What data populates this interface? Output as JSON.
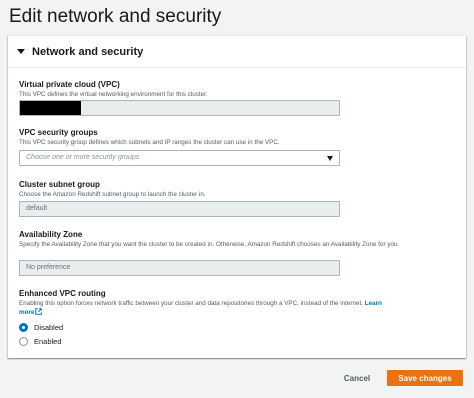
{
  "page": {
    "title": "Edit network and security"
  },
  "panel": {
    "title": "Network and security"
  },
  "vpc": {
    "label": "Virtual private cloud (VPC)",
    "description": "This VPC defines the virtual networking environment for this cluster."
  },
  "security_groups": {
    "label": "VPC security groups",
    "description": "This VPC security group defines which subnets and IP ranges the cluster can use in the VPC.",
    "placeholder": "Choose one or more security groups"
  },
  "subnet_group": {
    "label": "Cluster subnet group",
    "description": "Choose the Amazon Redshift subnet group to launch the cluster in.",
    "value": "default"
  },
  "availability_zone": {
    "label": "Availability Zone",
    "description": "Specify the Availability Zone that you want the cluster to be created in. Otherwise, Amazon Redshift chooses an Availability Zone for you.",
    "value": "No preference"
  },
  "enhanced_routing": {
    "label": "Enhanced VPC routing",
    "description": "Enabling this option forces network traffic between your cluster and data repositories through a VPC, instead of the internet.",
    "learn_more": "Learn more",
    "options": [
      {
        "label": "Disabled",
        "selected": true
      },
      {
        "label": "Enabled",
        "selected": false
      }
    ]
  },
  "footer": {
    "cancel_label": "Cancel",
    "save_label": "Save changes"
  },
  "colors": {
    "accent": "#0073bb",
    "primary_button": "#ec7211",
    "background": "#f2f3f3"
  },
  "icons": [
    "caret-down-icon",
    "external-link-icon"
  ]
}
